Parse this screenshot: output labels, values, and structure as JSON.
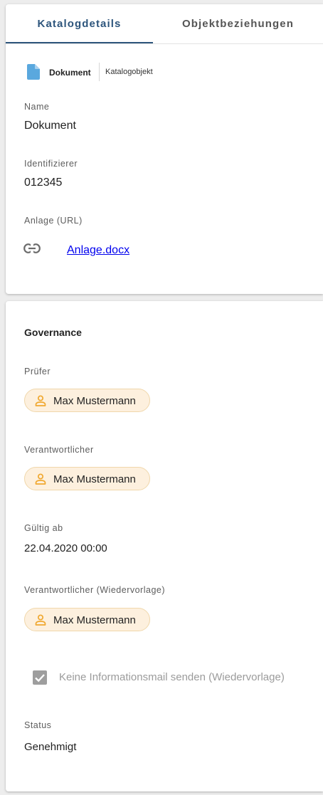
{
  "tabs": [
    {
      "label": "Katalogdetails",
      "active": true
    },
    {
      "label": "Objektbeziehungen",
      "active": false
    }
  ],
  "colors": {
    "accent": "#2d557c",
    "doc_icon": "#5aa8de",
    "chip_bg": "#fdf0de",
    "chip_border": "#f0d7ab",
    "person_icon": "#f0a830",
    "link": "#0000ee"
  },
  "object": {
    "icon": "document-icon",
    "type_label": "Dokument",
    "type_sub": "Katalogobjekt"
  },
  "details": {
    "name_label": "Name",
    "name_value": "Dokument",
    "id_label": "Identifizierer",
    "id_value": "012345",
    "attachment_label": "Anlage (URL)",
    "attachment_icon": "link-icon",
    "attachment_link": "Anlage.docx"
  },
  "governance": {
    "title": "Governance",
    "reviewer_label": "Prüfer",
    "reviewer": "Max Mustermann",
    "responsible_label": "Verantwortlicher",
    "responsible": "Max Mustermann",
    "valid_from_label": "Gültig ab",
    "valid_from": "22.04.2020 00:00",
    "resubmission_label": "Verantwortlicher (Wiedervorlage)",
    "resubmission": "Max Mustermann",
    "person_icon": "person-icon",
    "no_mail_label": "Keine Informationsmail senden (Wiedervorlage)",
    "no_mail_checked": true,
    "status_label": "Status",
    "status_value": "Genehmigt"
  }
}
